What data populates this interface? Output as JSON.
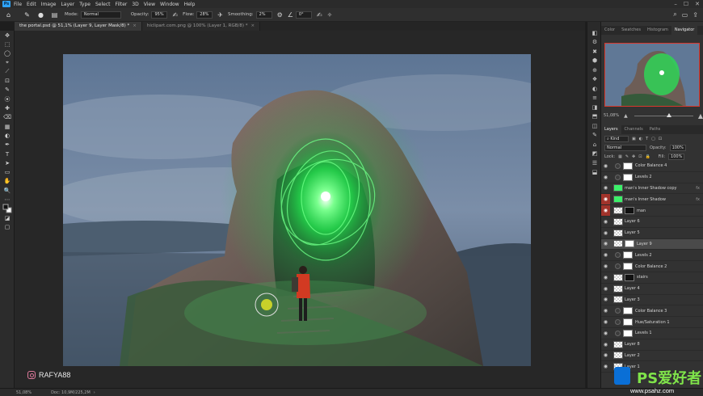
{
  "menubar": {
    "logo": "Ps",
    "items": [
      "File",
      "Edit",
      "Image",
      "Layer",
      "Type",
      "Select",
      "Filter",
      "3D",
      "View",
      "Window",
      "Help"
    ],
    "window_controls": [
      "–",
      "☐",
      "✕"
    ]
  },
  "options": {
    "mode_label": "Mode:",
    "mode_value": "Normal",
    "opacity_label": "Opacity:",
    "opacity_value": "95%",
    "flow_label": "Flow:",
    "flow_value": "28%",
    "smoothing_label": "Smoothing:",
    "smoothing_value": "2%",
    "angle_value": "0°"
  },
  "tabs": [
    {
      "label": "the portal.psd @ 51,1% (Layer 9, Layer Mask/8) *",
      "close": "×",
      "active": true
    },
    {
      "label": "hiclipart.com.png @ 100% (Layer 1, RGB/8) *",
      "close": "×",
      "active": false
    }
  ],
  "tools": [
    "✥",
    "⬚",
    "◯",
    "⌖",
    "⟋",
    "⊡",
    "✎",
    "⦿",
    "✚",
    "⌫",
    "▦",
    "◐",
    "✒",
    "T",
    "➤",
    "▭",
    "✋",
    "🔍",
    "⋯",
    "◪",
    "▢"
  ],
  "dock_icons": [
    "◧",
    "⚙",
    "✖",
    "⬢",
    "⊕",
    "❖",
    "◐",
    "≡",
    "◨",
    "⬒",
    "◫",
    "✎",
    "⌂",
    "◩",
    "☰",
    "⬓"
  ],
  "watermark": {
    "handle": "RAFYA88"
  },
  "status": {
    "zoom": "51,08%",
    "doc": "Doc: 10,9M/225,2M"
  },
  "panel": {
    "top_tabs": [
      "Color",
      "Swatches",
      "Histogram",
      "Navigator"
    ],
    "nav_zoom": "51,08%",
    "layer_tabs": [
      "Layers",
      "Channels",
      "Paths"
    ],
    "filter_kind": "Kind",
    "blend_mode": "Normal",
    "opacity_label": "Opacity:",
    "opacity_value": "100%",
    "lock_label": "Lock:",
    "fill_label": "Fill:",
    "fill_value": "100%"
  },
  "layers": [
    {
      "name": "Color Balance 4",
      "kind": "adj",
      "eye": "normal",
      "selected": false
    },
    {
      "name": "Levels 2",
      "kind": "adj",
      "eye": "normal",
      "selected": false
    },
    {
      "name": "man's Inner Shadow copy",
      "kind": "green",
      "eye": "normal",
      "selected": false,
      "fx": "fx"
    },
    {
      "name": "man's Inner Shadow",
      "kind": "green",
      "eye": "red",
      "selected": false,
      "fx": "fx"
    },
    {
      "name": "man",
      "kind": "checker",
      "eye": "red",
      "selected": false
    },
    {
      "name": "Layer 6",
      "kind": "checker",
      "eye": "normal",
      "selected": false
    },
    {
      "name": "Layer 5",
      "kind": "checker",
      "eye": "normal",
      "selected": false
    },
    {
      "name": "Layer 9",
      "kind": "checker",
      "eye": "normal",
      "selected": true
    },
    {
      "name": "Levels 2",
      "kind": "adj",
      "eye": "normal",
      "selected": false
    },
    {
      "name": "Color Balance 2",
      "kind": "adj",
      "eye": "normal",
      "selected": false
    },
    {
      "name": "stairs",
      "kind": "checker",
      "eye": "normal",
      "selected": false
    },
    {
      "name": "Layer 4",
      "kind": "checker",
      "eye": "normal",
      "selected": false
    },
    {
      "name": "Layer 3",
      "kind": "checker",
      "eye": "normal",
      "selected": false
    },
    {
      "name": "Color Balance 3",
      "kind": "adj",
      "eye": "normal",
      "selected": false
    },
    {
      "name": "Hue/Saturation 1",
      "kind": "adj",
      "eye": "normal",
      "selected": false
    },
    {
      "name": "Levels 1",
      "kind": "adj",
      "eye": "normal",
      "selected": false
    },
    {
      "name": "Layer 8",
      "kind": "checker",
      "eye": "normal",
      "selected": false
    },
    {
      "name": "Layer 2",
      "kind": "checker",
      "eye": "normal",
      "selected": false
    },
    {
      "name": "Layer 1",
      "kind": "checker",
      "eye": "normal",
      "selected": false
    }
  ],
  "site_logo": {
    "text": "PS爱好者",
    "url": "www.psahz.com"
  },
  "colors": {
    "accent_red": "#a1332b",
    "portal_green": "#3cf06a"
  }
}
